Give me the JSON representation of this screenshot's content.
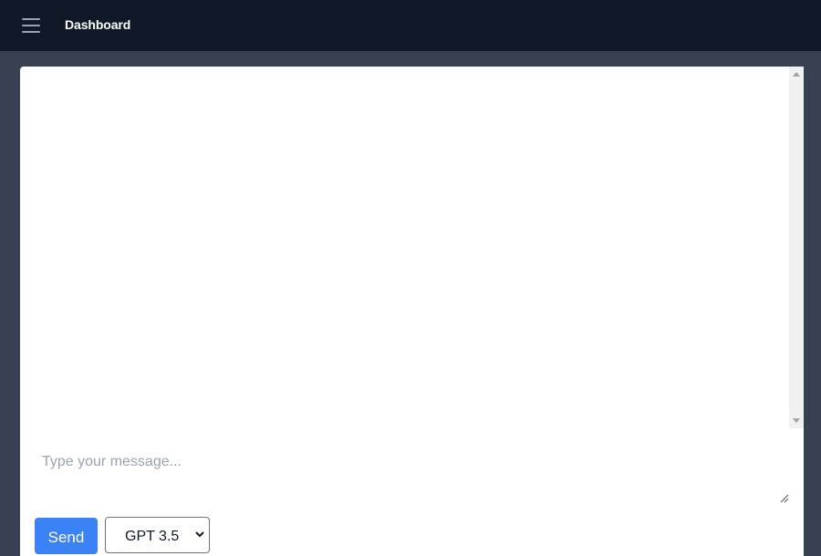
{
  "header": {
    "title": "Dashboard",
    "menu_icon": "hamburger-menu-icon"
  },
  "chat": {
    "messages": []
  },
  "composer": {
    "placeholder": "Type your message...",
    "value": "",
    "send_label": "Send",
    "model": {
      "selected": "GPT 3.5"
    }
  },
  "colors": {
    "topbar": "#111827",
    "background": "#374151",
    "accent": "#3b82f6"
  }
}
